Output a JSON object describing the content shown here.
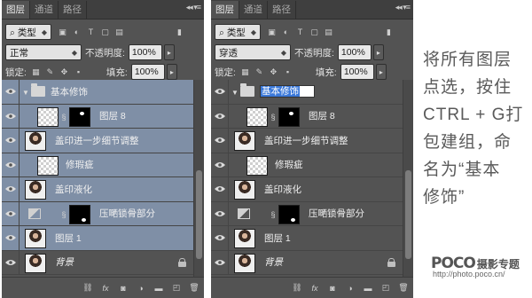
{
  "left_panel": {
    "tabs": [
      "图层",
      "通道",
      "路径"
    ],
    "filter": {
      "label": "类型"
    },
    "blend_mode": "正常",
    "opacity_label": "不透明度:",
    "opacity_value": "100%",
    "lock_label": "锁定:",
    "fill_label": "填充:",
    "fill_value": "100%",
    "layers": [
      {
        "name": "基本修饰",
        "kind": "group",
        "selected": true
      },
      {
        "name": "图层 8",
        "kind": "checker-mask",
        "selected": true
      },
      {
        "name": "盖印进一步细节调整",
        "kind": "photo",
        "selected": true
      },
      {
        "name": "修瑕疵",
        "kind": "checker",
        "selected": true
      },
      {
        "name": "盖印液化",
        "kind": "photo",
        "selected": true
      },
      {
        "name": "压嗮锁骨部分",
        "kind": "adjustment-mask",
        "selected": true
      },
      {
        "name": "图层 1",
        "kind": "photo",
        "selected": true
      },
      {
        "name": "背景",
        "kind": "background",
        "selected": false
      }
    ]
  },
  "right_panel": {
    "tabs": [
      "图层",
      "通道",
      "路径"
    ],
    "filter": {
      "label": "类型"
    },
    "blend_mode": "穿透",
    "opacity_label": "不透明度:",
    "opacity_value": "100%",
    "lock_label": "锁定:",
    "fill_label": "填充:",
    "fill_value": "100%",
    "editing_name": "基本修饰",
    "layers": [
      {
        "name": "基本修饰",
        "kind": "group",
        "selected": false
      },
      {
        "name": "图层 8",
        "kind": "checker-mask",
        "selected": false
      },
      {
        "name": "盖印进一步细节调整",
        "kind": "photo",
        "selected": false
      },
      {
        "name": "修瑕疵",
        "kind": "checker",
        "selected": false
      },
      {
        "name": "盖印液化",
        "kind": "photo",
        "selected": false
      },
      {
        "name": "压嗮锁骨部分",
        "kind": "adjustment-mask",
        "selected": false
      },
      {
        "name": "图层 1",
        "kind": "photo",
        "selected": false
      },
      {
        "name": "背景",
        "kind": "background",
        "selected": false
      }
    ]
  },
  "footer_icons": [
    "link-icon",
    "fx-icon",
    "mask-icon",
    "adjustment-icon",
    "folder-icon",
    "new-layer-icon",
    "trash-icon"
  ],
  "caption_lines": [
    "将所有图层",
    "点选，按住",
    "CTRL + G打",
    "包建组，命",
    "名为“基本",
    "修饰”"
  ],
  "logo": {
    "brand": "POCO",
    "sub": "摄影专题",
    "url": "http://photo.poco.cn/"
  },
  "colors": {
    "panel": "#535353",
    "selected_row": "#7f8fa6",
    "highlight": "#3a78d9"
  }
}
